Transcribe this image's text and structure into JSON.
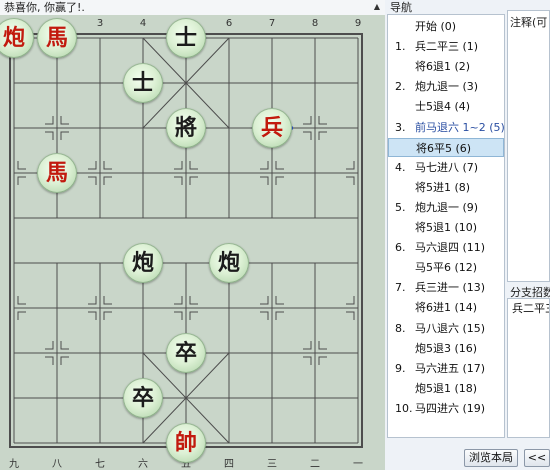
{
  "title_bar": {
    "text": "恭喜你, 你赢了!.",
    "scroll_glyph": "▲"
  },
  "board": {
    "top_labels": [
      "1",
      "2",
      "3",
      "4",
      "5",
      "6",
      "7",
      "8",
      "9"
    ],
    "bottom_labels": [
      "九",
      "八",
      "七",
      "六",
      "五",
      "四",
      "三",
      "二",
      "一"
    ],
    "colors": {
      "board_bg": "#c9d6c9",
      "line": "#4d4d4d",
      "arrow": "#2f55c8",
      "red": "#c21a0e"
    },
    "pieces": [
      {
        "char": "炮",
        "side": "red",
        "file": 1,
        "rank": 1
      },
      {
        "char": "馬",
        "side": "red",
        "file": 2,
        "rank": 1
      },
      {
        "char": "士",
        "side": "black",
        "file": 5,
        "rank": 1
      },
      {
        "char": "士",
        "side": "black",
        "file": 4,
        "rank": 2
      },
      {
        "char": "將",
        "side": "black",
        "file": 5,
        "rank": 3
      },
      {
        "char": "兵",
        "side": "red",
        "file": 7,
        "rank": 3
      },
      {
        "char": "馬",
        "side": "red",
        "file": 2,
        "rank": 4
      },
      {
        "char": "炮",
        "side": "black",
        "file": 4,
        "rank": 6
      },
      {
        "char": "炮",
        "side": "black",
        "file": 6,
        "rank": 6
      },
      {
        "char": "卒",
        "side": "black",
        "file": 5,
        "rank": 8
      },
      {
        "char": "卒",
        "side": "black",
        "file": 4,
        "rank": 9
      },
      {
        "char": "帥",
        "side": "red",
        "file": 5,
        "rank": 10
      }
    ]
  },
  "nav": {
    "title": "导航",
    "moves": [
      {
        "num": "",
        "text": "开始 (0)"
      },
      {
        "num": "1.",
        "text": "兵二平三 (1)"
      },
      {
        "num": "",
        "text": "将6退1 (2)"
      },
      {
        "num": "2.",
        "text": "炮九退一 (3)"
      },
      {
        "num": "",
        "text": "士5退4 (4)"
      },
      {
        "num": "3.",
        "text": "前马退六 1~2 (5)",
        "highlight_text": true
      },
      {
        "num": "",
        "text": "将6平5 (6)",
        "selected": true
      },
      {
        "num": "4.",
        "text": "马七进八 (7)"
      },
      {
        "num": "",
        "text": "将5进1 (8)"
      },
      {
        "num": "5.",
        "text": "炮九退一 (9)"
      },
      {
        "num": "",
        "text": "将5退1 (10)"
      },
      {
        "num": "6.",
        "text": "马六退四 (11)"
      },
      {
        "num": "",
        "text": "马5平6 (12)"
      },
      {
        "num": "7.",
        "text": "兵三进一 (13)"
      },
      {
        "num": "",
        "text": "将6进1 (14)"
      },
      {
        "num": "8.",
        "text": "马八退六 (15)"
      },
      {
        "num": "",
        "text": "炮5退3 (16)"
      },
      {
        "num": "9.",
        "text": "马六进五 (17)"
      },
      {
        "num": "",
        "text": "炮5退1 (18)"
      },
      {
        "num": "10.",
        "text": "马四进六 (19)"
      }
    ]
  },
  "comment": {
    "title": "注释(可"
  },
  "branch": {
    "title": "分支招数",
    "item": "兵二平三"
  },
  "buttons": {
    "browse": "浏览本局",
    "back": "<<"
  }
}
